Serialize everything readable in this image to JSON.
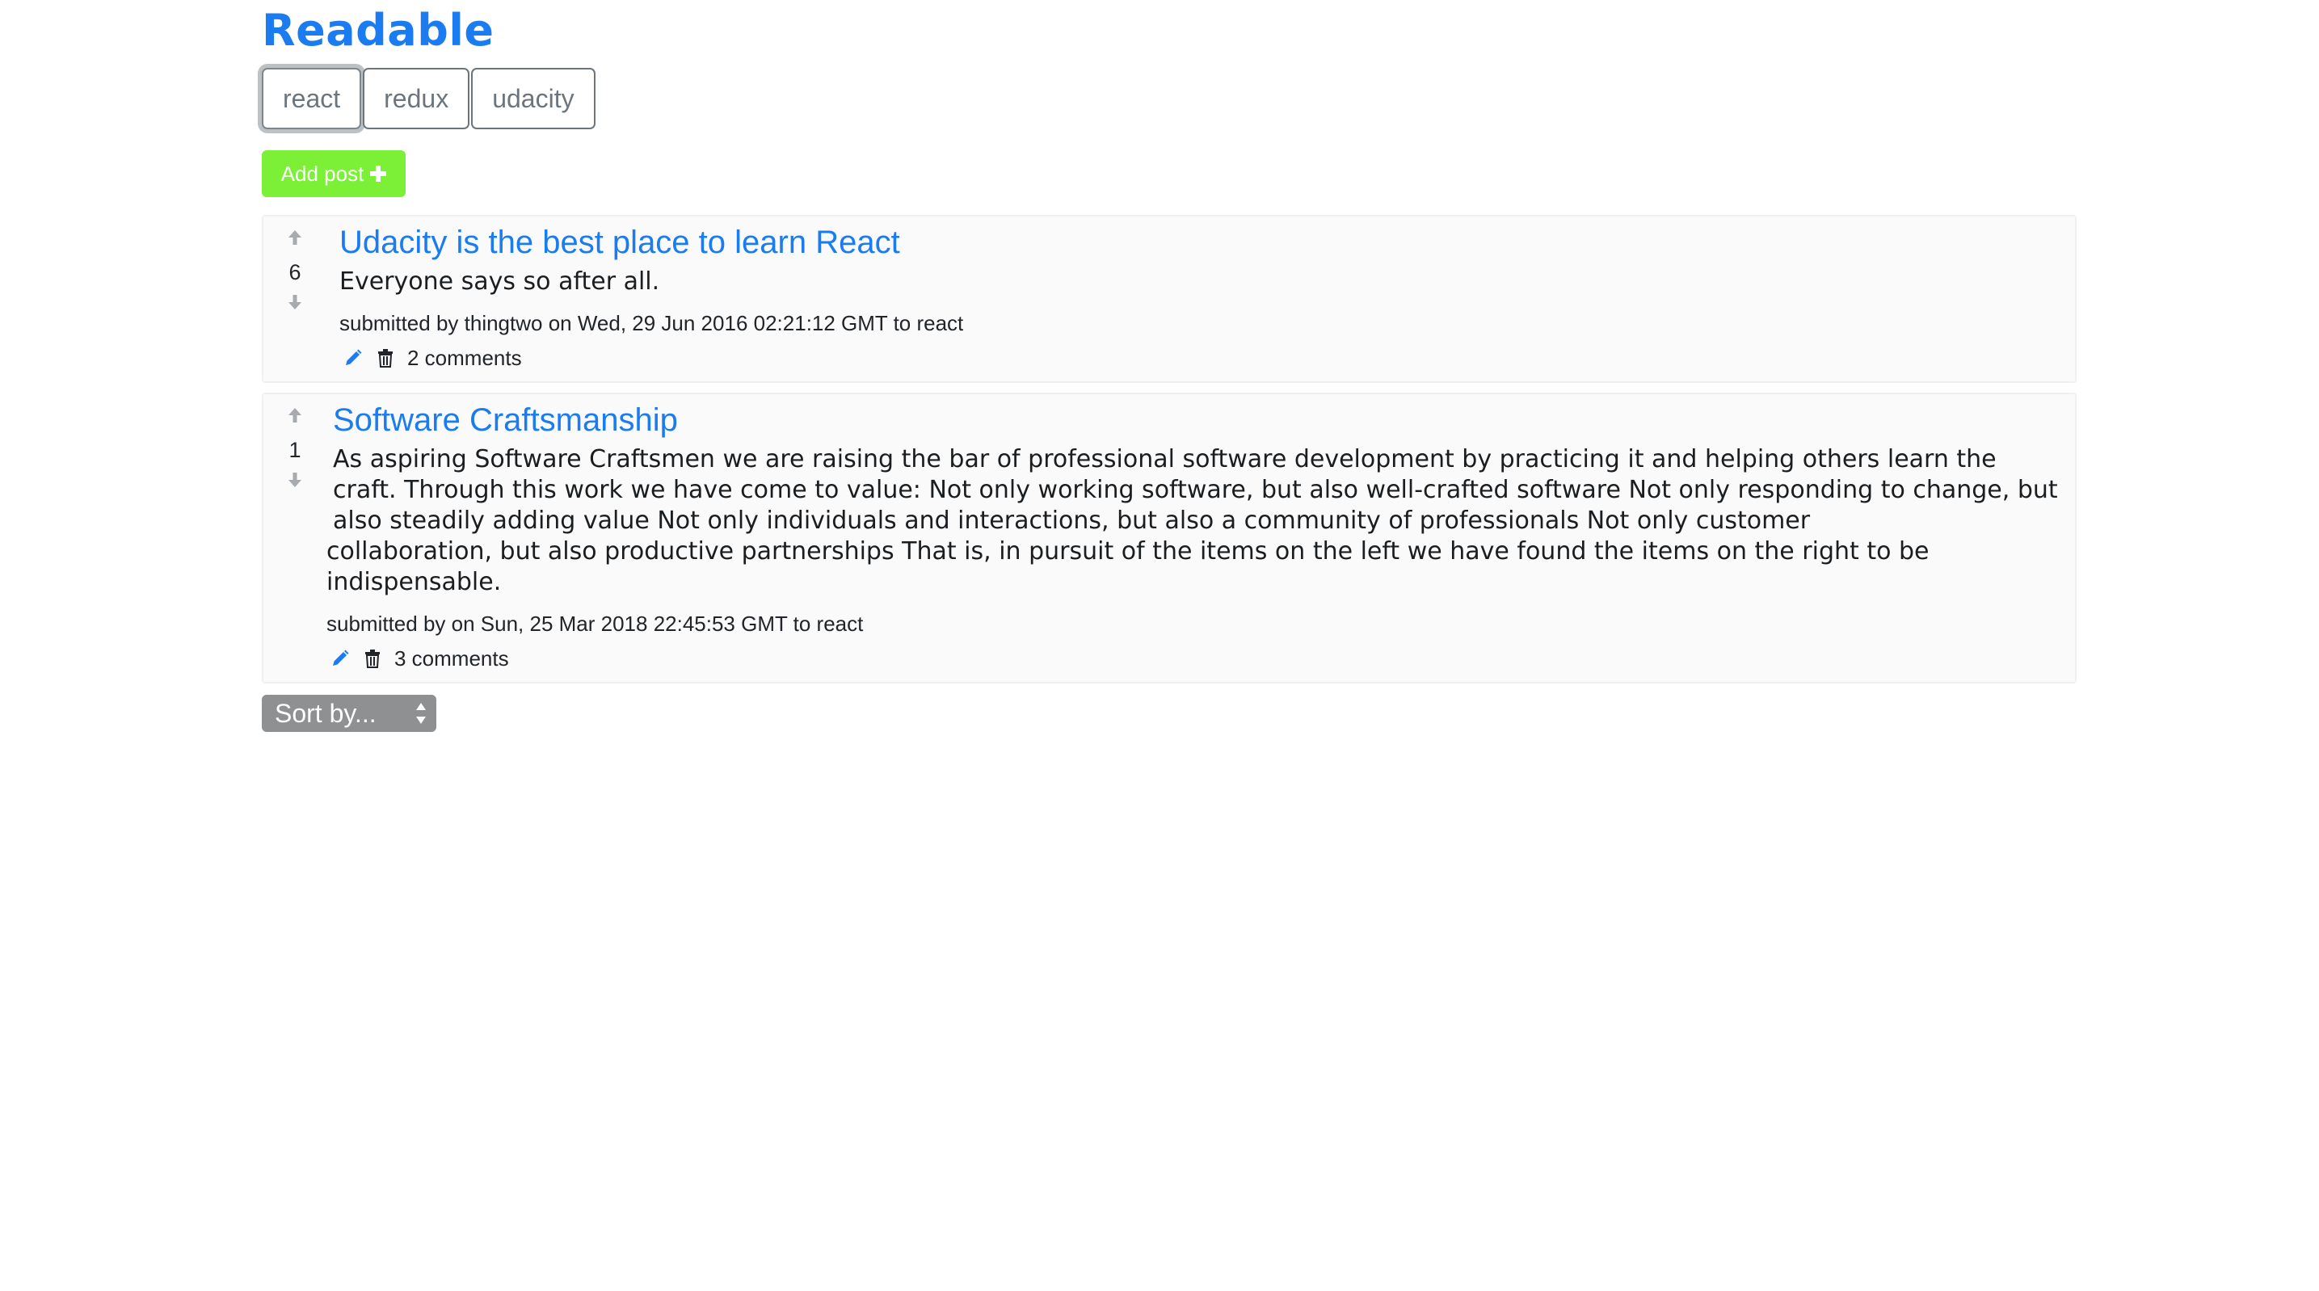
{
  "app": {
    "brand": "Readable"
  },
  "categories": [
    {
      "label": "react",
      "active": true
    },
    {
      "label": "redux",
      "active": false
    },
    {
      "label": "udacity",
      "active": false
    }
  ],
  "add_post": {
    "label": "Add post",
    "icon": "plus-icon"
  },
  "posts": [
    {
      "score": "6",
      "title": "Udacity is the best place to learn React",
      "body": "Everyone says so after all.",
      "meta": "submitted by thingtwo on Wed, 29 Jun 2016 02:21:12 GMT to react",
      "comments": "2 comments"
    },
    {
      "score": "1",
      "title": "Software Craftsmanship",
      "body_first": "As aspiring Software Craftsmen we are raising the bar of professional software development by practicing it and helping others learn the craft. Through this work we have come to value: Not only working software, but also well-crafted software Not only responding to change, but also steadily adding value Not only individuals and interactions, but also a community of professionals Not only customer",
      "body_rest": "collaboration, but also productive partnerships That is, in pursuit of the items on the left we have found the items on the right to be indispensable.",
      "meta": "submitted by on Sun, 25 Mar 2018 22:45:53 GMT to react",
      "comments": "3 comments"
    }
  ],
  "sort": {
    "selected": "Sort by..."
  },
  "colors": {
    "brand": "#1a7cf0",
    "add_post": "#7cf036",
    "sort_bg": "#8f9092"
  }
}
